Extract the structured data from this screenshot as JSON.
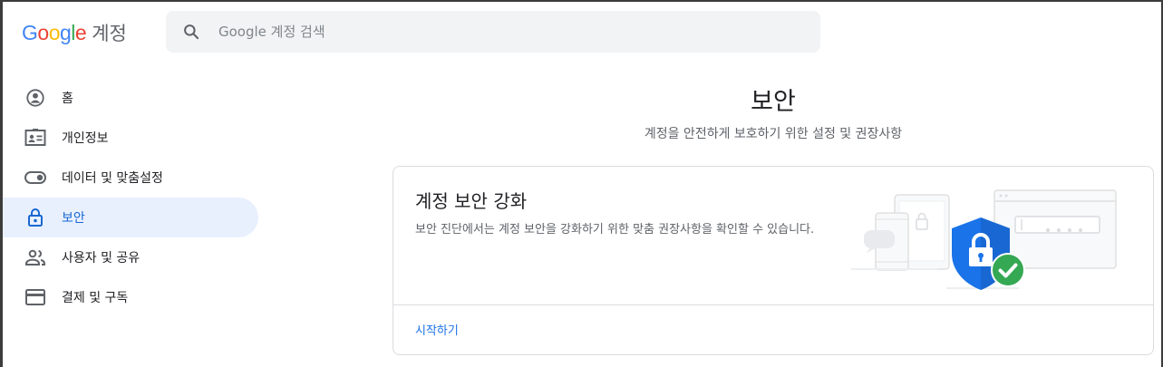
{
  "header": {
    "logo_letters": [
      {
        "char": "G",
        "color": "#4285F4"
      },
      {
        "char": "o",
        "color": "#EA4335"
      },
      {
        "char": "o",
        "color": "#FBBC05"
      },
      {
        "char": "g",
        "color": "#4285F4"
      },
      {
        "char": "l",
        "color": "#34A853"
      },
      {
        "char": "e",
        "color": "#EA4335"
      }
    ],
    "logo_suffix": "계정",
    "search": {
      "icon": "search-icon",
      "placeholder": "Google 계정 검색",
      "value": ""
    }
  },
  "sidebar": {
    "items": [
      {
        "label": "홈",
        "icon": "account-circle-icon",
        "active": false
      },
      {
        "label": "개인정보",
        "icon": "id-card-icon",
        "active": false
      },
      {
        "label": "데이터 및 맞춤설정",
        "icon": "toggle-icon",
        "active": false
      },
      {
        "label": "보안",
        "icon": "lock-icon",
        "active": true
      },
      {
        "label": "사용자 및 공유",
        "icon": "people-icon",
        "active": false
      },
      {
        "label": "결제 및 구독",
        "icon": "credit-card-icon",
        "active": false
      }
    ]
  },
  "main": {
    "title": "보안",
    "subtitle": "계정을 안전하게 보호하기 위한 설정 및 권장사항",
    "card": {
      "title": "계정 보안 강화",
      "description": "보안 진단에서는 계정 보안을 강화하기 위한 맞춤 권장사항을 확인할 수 있습니다.",
      "illustration": "security-shield-illustration",
      "link_label": "시작하기"
    }
  },
  "colors": {
    "accent": "#1a73e8",
    "active_bg": "#e8f0fe",
    "active_text": "#1967d2",
    "shield_blue": "#1a73e8",
    "check_green": "#34a853"
  }
}
